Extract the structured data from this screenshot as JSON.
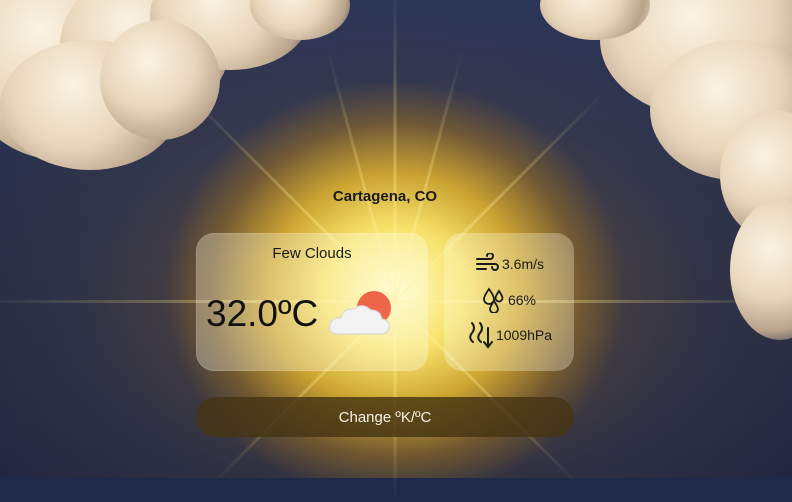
{
  "location": "Cartagena, CO",
  "weather": {
    "condition": "Few Clouds",
    "temperature": "32.0ºC",
    "icon": "sun-behind-cloud-icon"
  },
  "details": {
    "wind": {
      "value": "3.6m/s",
      "icon": "wind-icon"
    },
    "humidity": {
      "value": "66%",
      "icon": "humidity-icon"
    },
    "pressure": {
      "value": "1009hPa",
      "icon": "pressure-icon"
    }
  },
  "toggle_button": {
    "label": "Change ºK/ºC"
  },
  "colors": {
    "sun": "#f0604a",
    "button": "#46341a",
    "text": "#1a1a1a"
  }
}
